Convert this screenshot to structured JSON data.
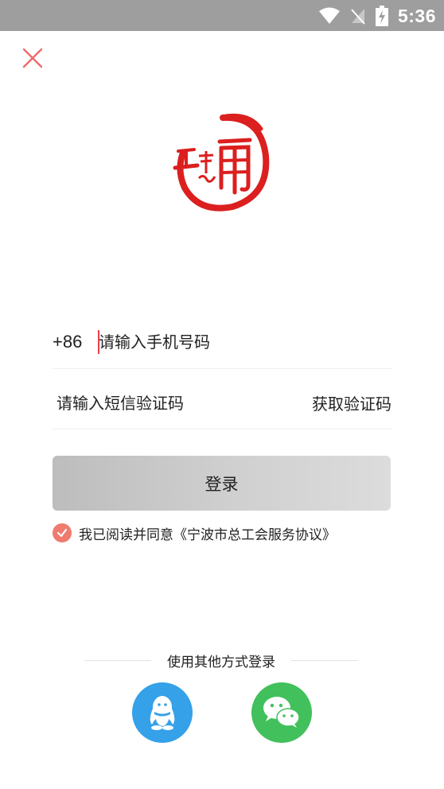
{
  "status_bar": {
    "time": "5:36",
    "icons": [
      "wifi-icon",
      "no-signal-icon",
      "battery-charging-icon"
    ]
  },
  "close_icon": "close-icon",
  "logo": {
    "icon": "stamp-logo",
    "color": "#dc1f1f"
  },
  "login_form": {
    "country_code": "+86",
    "phone_placeholder": "请输入手机号码",
    "sms_placeholder": "请输入短信验证码",
    "get_code_label": "获取验证码",
    "login_label": "登录",
    "agreement_checked": true,
    "agreement_text": "我已阅读并同意《宁波市总工会服务协议》"
  },
  "other_login": {
    "label": "使用其他方式登录",
    "methods": [
      {
        "name": "QQ",
        "icon": "qq-icon",
        "color": "#35a1e8"
      },
      {
        "name": "WeChat",
        "icon": "wechat-icon",
        "color": "#42c05c"
      }
    ]
  },
  "colors": {
    "accent": "#e8424c",
    "checkbox": "#f07a6e",
    "status_bar": "#9e9e9e"
  }
}
